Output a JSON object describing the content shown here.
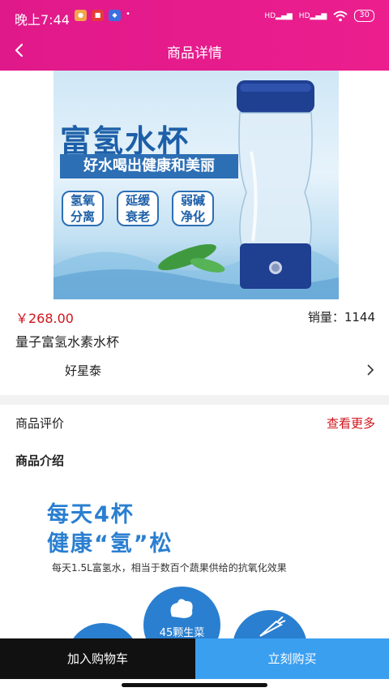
{
  "status": {
    "time": "晚上7:44",
    "battery": "30",
    "net1": "HD",
    "net2": "HD"
  },
  "nav": {
    "title": "商品详情"
  },
  "hero": {
    "title": "富氢水杯",
    "band": "好水喝出健康和美丽",
    "badges": [
      {
        "line1": "氢氧",
        "line2": "分离"
      },
      {
        "line1": "延缓",
        "line2": "衰老"
      },
      {
        "line1": "弱碱",
        "line2": "净化"
      }
    ]
  },
  "product": {
    "price": "￥268.00",
    "sales": "销量：1144",
    "name": "量子富氢水素水杯",
    "store": "好星泰"
  },
  "review": {
    "label": "商品评价",
    "more": "查看更多"
  },
  "intro": {
    "title": "商品介绍",
    "line1": "每天4杯",
    "line2": "健康“氢”松",
    "sub": "每天1.5L富氢水，相当于数百个蔬果供给的抗氧化效果",
    "circle_label": "45颗生菜"
  },
  "actions": {
    "cart": "加入购物车",
    "buy": "立刻购买"
  },
  "colors": {
    "accent": "#e0198a",
    "price": "#d0151c",
    "buy": "#3b9ff0"
  }
}
